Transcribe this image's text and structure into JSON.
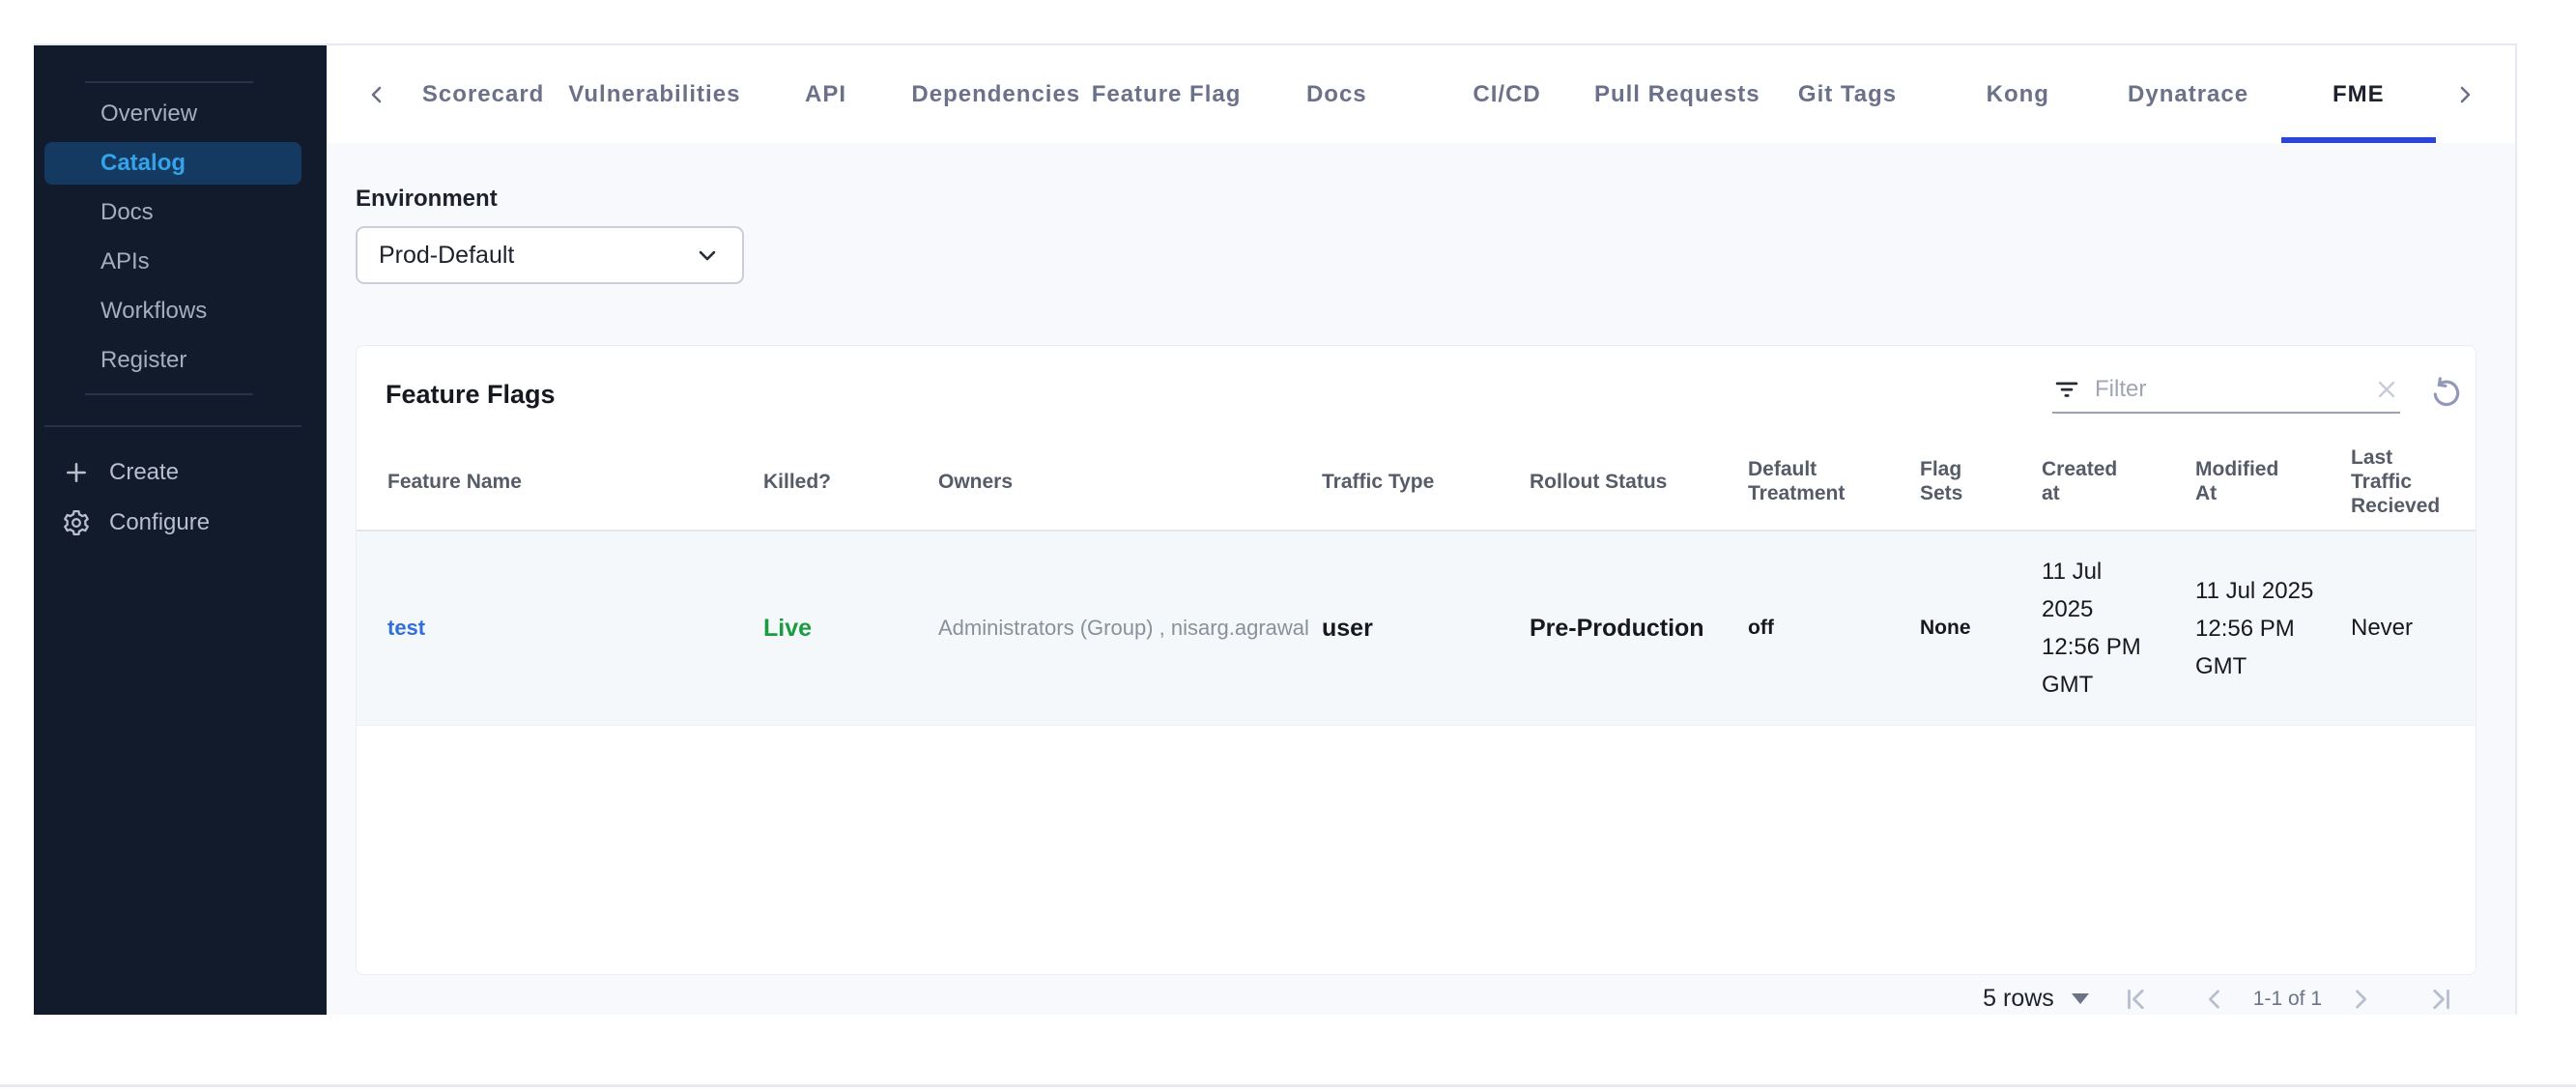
{
  "sidebar": {
    "items": [
      {
        "label": "Overview",
        "active": false
      },
      {
        "label": "Catalog",
        "active": true
      },
      {
        "label": "Docs",
        "active": false
      },
      {
        "label": "APIs",
        "active": false
      },
      {
        "label": "Workflows",
        "active": false
      },
      {
        "label": "Register",
        "active": false
      }
    ],
    "actions": {
      "create": "Create",
      "configure": "Configure"
    }
  },
  "tabs": {
    "items": [
      "Scorecard",
      "Vulnerabilities",
      "API",
      "Dependencies",
      "Feature Flag",
      "Docs",
      "CI/CD",
      "Pull Requests",
      "Git Tags",
      "Kong",
      "Dynatrace",
      "FME"
    ],
    "active": "FME"
  },
  "environment": {
    "label": "Environment",
    "selected": "Prod-Default"
  },
  "panel": {
    "title": "Feature Flags",
    "filter_placeholder": "Filter"
  },
  "table": {
    "columns": [
      "Feature Name",
      "Killed?",
      "Owners",
      "Traffic Type",
      "Rollout Status",
      "Default Treatment",
      "Flag Sets",
      "Created at",
      "Modified At",
      "Last Traffic Recieved"
    ],
    "row": {
      "feature_name": "test",
      "killed": "Live",
      "owners": "Administrators (Group) , nisarg.agrawal",
      "traffic_type": "user",
      "rollout_status": "Pre-Production",
      "default_treatment": "off",
      "flag_sets": "None",
      "created_at": "11 Jul 2025 12:56 PM GMT",
      "modified_at": "11 Jul 2025 12:56 PM GMT",
      "last_traffic_recieved": "Never"
    }
  },
  "pagination": {
    "rows_per_page": "5 rows",
    "range": "1-1 of 1"
  },
  "colors": {
    "sidebar_bg": "#111b2b",
    "sidebar_active_bg": "#143a61",
    "sidebar_active_text": "#35a2e9",
    "tab_underline": "#2946d9",
    "link_blue": "#2f6edc",
    "live_green": "#1b9c41",
    "row_bg": "#f4f8fb",
    "page_bg": "#f7f9fc"
  }
}
